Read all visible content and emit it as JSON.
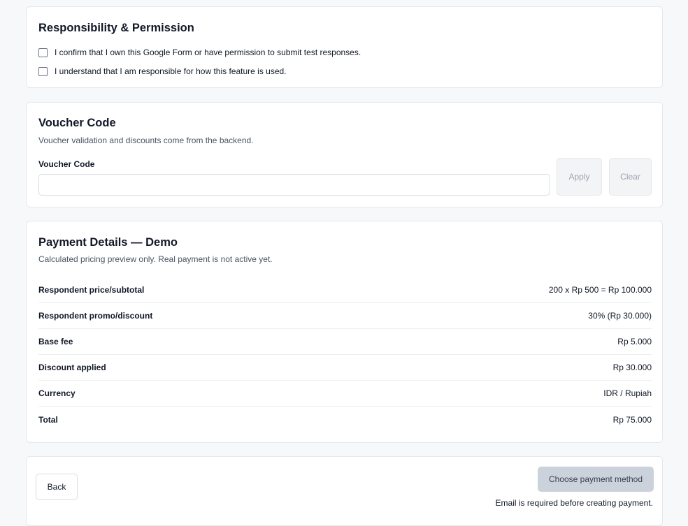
{
  "responsibility": {
    "title": "Responsibility & Permission",
    "checks": [
      {
        "label": "I confirm that I own this Google Form or have permission to submit test responses.",
        "checked": false
      },
      {
        "label": "I understand that I am responsible for how this feature is used.",
        "checked": false
      }
    ]
  },
  "voucher": {
    "title": "Voucher Code",
    "subtitle": "Voucher validation and discounts come from the backend.",
    "field_label": "Voucher Code",
    "value": "",
    "placeholder": "",
    "apply_label": "Apply",
    "clear_label": "Clear"
  },
  "payment": {
    "title": "Payment Details — Demo",
    "subtitle": "Calculated pricing preview only. Real payment is not active yet.",
    "rows": [
      {
        "label": "Respondent price/subtotal",
        "value": "200 x Rp 500 = Rp 100.000"
      },
      {
        "label": "Respondent promo/discount",
        "value": "30% (Rp 30.000)"
      },
      {
        "label": "Base fee",
        "value": "Rp 5.000"
      },
      {
        "label": "Discount applied",
        "value": "Rp 30.000"
      },
      {
        "label": "Currency",
        "value": "IDR / Rupiah"
      },
      {
        "label": "Total",
        "value": "Rp 75.000"
      }
    ]
  },
  "actions": {
    "back_label": "Back",
    "pay_label": "Choose payment method",
    "note": "Email is required before creating payment."
  }
}
